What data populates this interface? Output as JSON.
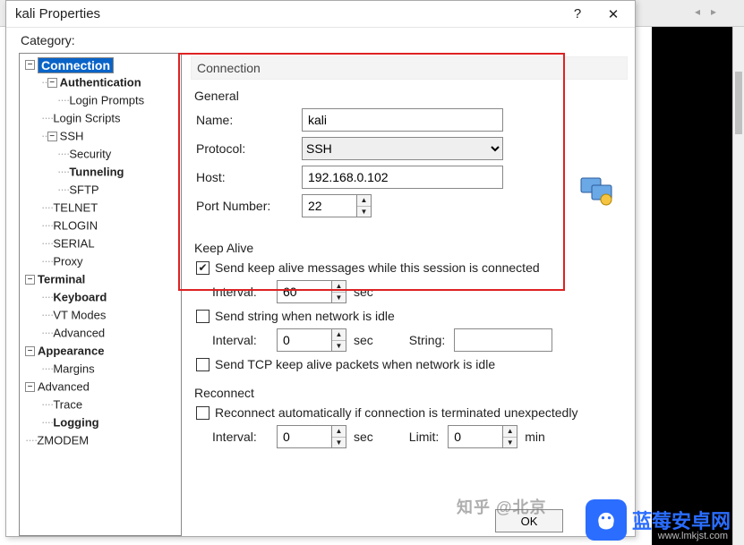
{
  "window": {
    "title": "kali Properties",
    "help": "?",
    "close": "✕"
  },
  "category_label": "Category:",
  "tree": {
    "connection": "Connection",
    "authentication": "Authentication",
    "login_prompts": "Login Prompts",
    "login_scripts": "Login Scripts",
    "ssh": "SSH",
    "security": "Security",
    "tunneling": "Tunneling",
    "sftp": "SFTP",
    "telnet": "TELNET",
    "rlogin": "RLOGIN",
    "serial": "SERIAL",
    "proxy": "Proxy",
    "terminal": "Terminal",
    "keyboard": "Keyboard",
    "vt_modes": "VT Modes",
    "advanced1": "Advanced",
    "appearance": "Appearance",
    "margins": "Margins",
    "advanced2": "Advanced",
    "trace": "Trace",
    "logging": "Logging",
    "zmodem": "ZMODEM"
  },
  "section": {
    "connection": "Connection",
    "general": "General",
    "keep_alive": "Keep Alive",
    "reconnect": "Reconnect"
  },
  "general": {
    "name_label": "Name:",
    "name_value": "kali",
    "protocol_label": "Protocol:",
    "protocol_value": "SSH",
    "host_label": "Host:",
    "host_value": "192.168.0.102",
    "port_label": "Port Number:",
    "port_value": "22"
  },
  "keepalive": {
    "chk1_label": "Send keep alive messages while this session is connected",
    "interval_label": "Interval:",
    "interval1_value": "60",
    "sec": "sec",
    "chk2_label": "Send string when network is idle",
    "interval2_value": "0",
    "string_label": "String:",
    "chk3_label": "Send TCP keep alive packets when network is idle"
  },
  "reconnect": {
    "chk_label": "Reconnect automatically if connection is terminated unexpectedly",
    "interval_label": "Interval:",
    "interval_value": "0",
    "sec": "sec",
    "limit_label": "Limit:",
    "limit_value": "0",
    "min": "min"
  },
  "buttons": {
    "ok": "OK"
  },
  "watermark": "知乎 @北京",
  "brand": {
    "name": "蓝莓安卓网",
    "url": "www.lmkjst.com"
  }
}
